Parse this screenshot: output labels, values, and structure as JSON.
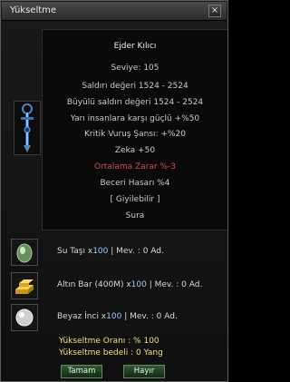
{
  "window": {
    "title": "Yükseltme",
    "close_glyph": "×"
  },
  "item": {
    "name": "Ejder Kılıcı",
    "level": "Seviye: 105",
    "stats": [
      "Saldırı değeri 1524 - 2524",
      "Büyülü saldırı değeri 1524 - 2524",
      "Yarı insanlara karşı güçlü +%50",
      "Kritik Vuruş Şansı: +%20",
      "Zeka +50",
      "Ortalama Zarar %-3",
      "Beceri Hasarı %4"
    ],
    "wearable": "[ Giyilebilir ]",
    "class": "Sura",
    "icon": "dragon-sword-icon"
  },
  "materials": [
    {
      "name": "Su Taşı x",
      "qty": "100",
      "sep": " | Mev. : ",
      "have": "0",
      "unit": " Ad.",
      "icon": "water-stone-icon"
    },
    {
      "name": "Altın Bar (400M) x",
      "qty": "100",
      "sep": " | Mev. : ",
      "have": "0",
      "unit": " Ad.",
      "icon": "gold-bar-icon"
    },
    {
      "name": "Beyaz İnci x",
      "qty": "100",
      "sep": " | Mev. : ",
      "have": "0",
      "unit": " Ad.",
      "icon": "white-pearl-icon"
    }
  ],
  "upgrade": {
    "rate": "Yükseltme Oranı : % 100",
    "cost": "Yükseltme bedeli : 0 Yang"
  },
  "buttons": {
    "ok": "Tamam",
    "cancel": "Hayır"
  },
  "colors": {
    "accent_yellow": "#f0e07a",
    "stat_red": "#d24c4c",
    "qty_blue": "#9fc5ff",
    "button_green": "#2f5a2f"
  }
}
